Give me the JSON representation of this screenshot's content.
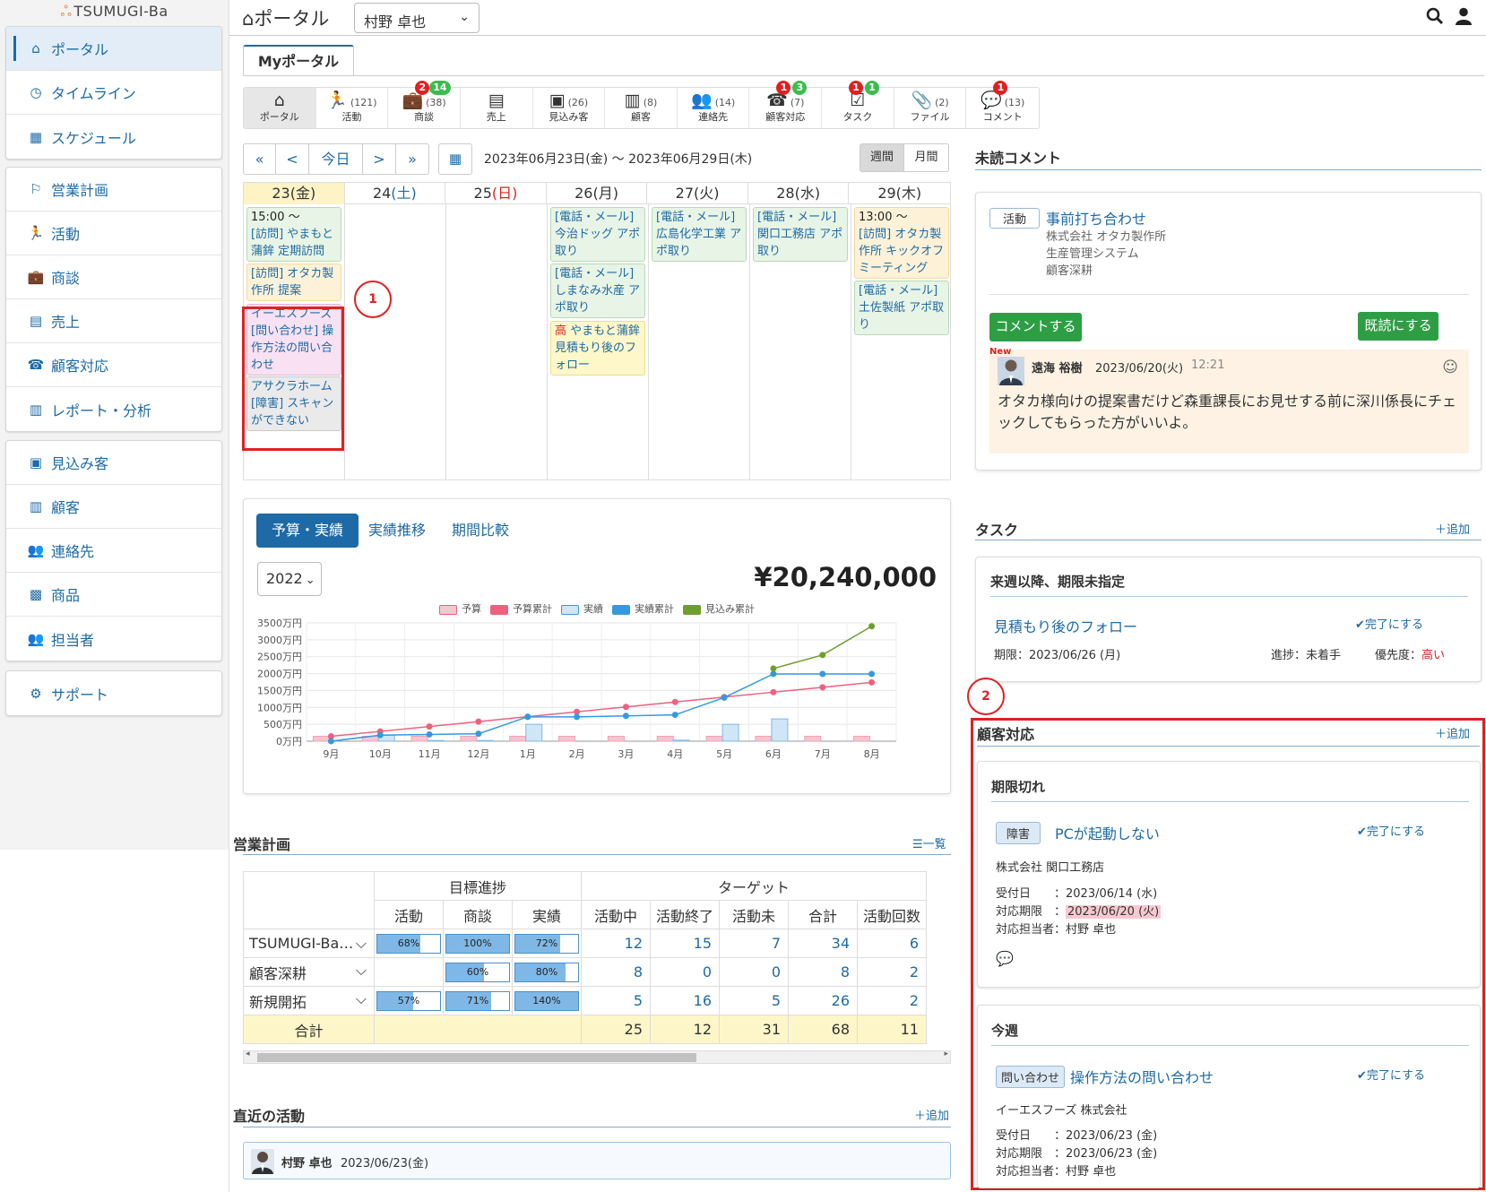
{
  "sidebar": {
    "brand": "TSUMUGI-Ba",
    "group1": [
      {
        "label": "ポータル",
        "icon": "home-icon",
        "glyph": "⌂",
        "active": true
      },
      {
        "label": "タイムライン",
        "icon": "clock-icon",
        "glyph": "◷"
      },
      {
        "label": "スケジュール",
        "icon": "calendar-icon",
        "glyph": "▦"
      }
    ],
    "group2": [
      {
        "label": "営業計画",
        "icon": "flag-icon",
        "glyph": "⚐"
      },
      {
        "label": "活動",
        "icon": "running-icon",
        "glyph": "🏃"
      },
      {
        "label": "商談",
        "icon": "briefcase-icon",
        "glyph": "💼"
      },
      {
        "label": "売上",
        "icon": "invoice-icon",
        "glyph": "▤"
      },
      {
        "label": "顧客対応",
        "icon": "phone-icon",
        "glyph": "☎"
      },
      {
        "label": "レポート・分析",
        "icon": "bar-chart-icon",
        "glyph": "▥"
      }
    ],
    "group3": [
      {
        "label": "見込み客",
        "icon": "id-card-icon",
        "glyph": "▣"
      },
      {
        "label": "顧客",
        "icon": "building-icon",
        "glyph": "▥"
      },
      {
        "label": "連絡先",
        "icon": "users-icon",
        "glyph": "👥"
      },
      {
        "label": "商品",
        "icon": "boxes-icon",
        "glyph": "▩"
      },
      {
        "label": "担当者",
        "icon": "users-icon",
        "glyph": "👥"
      }
    ],
    "group4": [
      {
        "label": "サポート",
        "icon": "user-gear-icon",
        "glyph": "⚙"
      }
    ]
  },
  "header": {
    "title": "ポータル",
    "user_select": "村野 卓也"
  },
  "tab": "Myポータル",
  "quick": [
    {
      "label": "ポータル",
      "count": "",
      "icon": "home-icon",
      "glyph": "⌂"
    },
    {
      "label": "活動",
      "count": "(121)",
      "icon": "running-icon",
      "glyph": "🏃"
    },
    {
      "label": "商談",
      "count": "(38)",
      "icon": "briefcase-icon",
      "glyph": "💼",
      "badge_red": "2",
      "badge_green": "14"
    },
    {
      "label": "売上",
      "count": "",
      "icon": "invoice-icon",
      "glyph": "▤"
    },
    {
      "label": "見込み客",
      "count": "(26)",
      "icon": "id-card-icon",
      "glyph": "▣"
    },
    {
      "label": "顧客",
      "count": "(8)",
      "icon": "building-icon",
      "glyph": "▥"
    },
    {
      "label": "連絡先",
      "count": "(14)",
      "icon": "users-icon",
      "glyph": "👥"
    },
    {
      "label": "顧客対応",
      "count": "(7)",
      "icon": "phone-icon",
      "glyph": "☎",
      "badge_red": "1",
      "badge_green": "3"
    },
    {
      "label": "タスク",
      "count": "",
      "icon": "tasks-icon",
      "glyph": "☑",
      "badge_red": "1",
      "badge_green": "1"
    },
    {
      "label": "ファイル",
      "count": "(2)",
      "icon": "paperclip-icon",
      "glyph": "📎"
    },
    {
      "label": "コメント",
      "count": "(13)",
      "icon": "comments-icon",
      "glyph": "💬",
      "badge_red": "1"
    }
  ],
  "calendar": {
    "nav": [
      "«",
      "<",
      "今日",
      ">",
      "»"
    ],
    "range": "2023年06月23日(金) ～ 2023年06月29日(木)",
    "view_week": "週間",
    "view_month": "月間",
    "days": [
      {
        "num": "23",
        "dow": "(金)",
        "kind": "today"
      },
      {
        "num": "24",
        "dow": "(土)",
        "kind": "sat"
      },
      {
        "num": "25",
        "dow": "(日)",
        "kind": "sun"
      },
      {
        "num": "26",
        "dow": "(月)",
        "kind": ""
      },
      {
        "num": "27",
        "dow": "(火)",
        "kind": ""
      },
      {
        "num": "28",
        "dow": "(水)",
        "kind": ""
      },
      {
        "num": "29",
        "dow": "(木)",
        "kind": ""
      }
    ],
    "events": {
      "e1_time": "15:00 ～",
      "e1_text": "[訪問] やまもと蒲鉾 定期訪問",
      "e2_text": "[訪問] オタカ製作所 提案",
      "e3_text": "イーエスフーズ [問い合わせ] 操作方法の問い合わせ",
      "e4_text": "アサクラホーム [障害] スキャンができない",
      "e5_text": "[電話・メール] 今治ドッグ アポ取り",
      "e6_text": "[電話・メール] しまなみ水産 アポ取り",
      "e7_pri": "高",
      "e7_text": "やまもと蒲鉾 見積もり後のフォロー",
      "e8_text": "[電話・メール] 広島化学工業 アポ取り",
      "e9_text": "[電話・メール] 関口工務店 アポ取り",
      "e10_time": "13:00 ～",
      "e10_text": "[訪問] オタカ製作所 キックオフミーティング",
      "e11_text": "[電話・メール] 土佐製紙 アポ取り"
    }
  },
  "annotations": {
    "one": "1",
    "two": "2"
  },
  "budget": {
    "tabs": [
      "予算・実績",
      "実績推移",
      "期間比較"
    ],
    "year": "2022",
    "total": "¥20,240,000"
  },
  "chart_data": {
    "type": "bar",
    "categories": [
      "9月",
      "10月",
      "11月",
      "12月",
      "1月",
      "2月",
      "3月",
      "4月",
      "5月",
      "6月",
      "7月",
      "8月"
    ],
    "y_ticks": [
      "0万円",
      "500万円",
      "1000万円",
      "1500万円",
      "2000万円",
      "2500万円",
      "3000万円",
      "3500万円"
    ],
    "ylim": [
      0,
      3500
    ],
    "unit": "万円",
    "series": [
      {
        "name": "予算",
        "kind": "bar",
        "color": "#f7c5d0",
        "values": [
          145,
          145,
          145,
          145,
          145,
          145,
          145,
          145,
          145,
          145,
          145,
          145
        ]
      },
      {
        "name": "予算累計",
        "kind": "line",
        "color": "#f0607f",
        "values": [
          145,
          290,
          435,
          580,
          725,
          870,
          1015,
          1160,
          1305,
          1450,
          1595,
          1740
        ]
      },
      {
        "name": "実績",
        "kind": "bar",
        "color": "#cfe6f7",
        "values": [
          0,
          180,
          20,
          20,
          500,
          0,
          0,
          30,
          500,
          660,
          0,
          0
        ]
      },
      {
        "name": "実績累計",
        "kind": "line",
        "color": "#3599e0",
        "values": [
          0,
          180,
          200,
          220,
          720,
          720,
          750,
          780,
          1290,
          1990,
          1990,
          1990
        ]
      },
      {
        "name": "見込み累計",
        "kind": "line",
        "color": "#6e9e2c",
        "values": [
          null,
          null,
          null,
          null,
          null,
          null,
          null,
          null,
          null,
          2150,
          2550,
          3400
        ]
      }
    ],
    "grid": true,
    "legend": "top"
  },
  "plan": {
    "title": "営業計画",
    "link": "一覧",
    "h_target_progress": "目標進捗",
    "h_target": "ターゲット",
    "cols": [
      "活動",
      "商談",
      "実績",
      "活動中",
      "活動終了",
      "活動未",
      "合計",
      "活動回数"
    ],
    "rows": [
      {
        "name": "TSUMUGI-Ba…",
        "p1": 68,
        "p1t": "68%",
        "p2": 100,
        "p2t": "100%",
        "p3": 72,
        "p3t": "72%",
        "v": [
          "12",
          "15",
          "7",
          "34",
          "6"
        ]
      },
      {
        "name": "顧客深耕",
        "p1": null,
        "p1t": "",
        "p2": 60,
        "p2t": "60%",
        "p3": 80,
        "p3t": "80%",
        "v": [
          "8",
          "0",
          "0",
          "8",
          "2"
        ]
      },
      {
        "name": "新規開拓",
        "p1": 57,
        "p1t": "57%",
        "p2": 71,
        "p2t": "71%",
        "p3": 100,
        "p3t": "140%",
        "v": [
          "5",
          "16",
          "5",
          "26",
          "2"
        ]
      }
    ],
    "sum_label": "合計",
    "sum": [
      "25",
      "12",
      "31",
      "68",
      "11"
    ]
  },
  "recent": {
    "title": "直近の活動",
    "add": "追加",
    "user": "村野 卓也",
    "date": "2023/06/23(金)"
  },
  "unread": {
    "title": "未読コメント",
    "tag": "活動",
    "subject": "事前打ち合わせ",
    "lines": [
      "株式会社 オタカ製作所",
      "生産管理システム",
      "顧客深耕"
    ],
    "btn_comment": "コメントする",
    "btn_read": "既読にする",
    "new": "New",
    "author": "遠海 裕樹",
    "date": "2023/06/20(火)",
    "time": "12:21",
    "body": "オタカ様向けの提案書だけど森重課長にお見せする前に深川係長にチェックしてもらった方がいいよ。"
  },
  "tasks": {
    "title": "タスク",
    "add": "追加",
    "section": "来週以降、期限未指定",
    "item": "見積もり後のフォロー",
    "done": "完了にする",
    "due": "期限：2023/06/26 (月)",
    "status_label": "進捗：",
    "status": "未着手",
    "prio_label": "優先度：",
    "prio": "高い"
  },
  "support": {
    "title": "顧客対応",
    "add": "追加",
    "done": "完了にする",
    "s1": "期限切れ",
    "c1_tag": "障害",
    "c1_subject": "PCが起動しない",
    "c1_company": "株式会社 関口工務店",
    "c1_recv_label": "受付日　　：",
    "c1_recv": "2023/06/14 (水)",
    "c1_due_label": "対応期限　：",
    "c1_due": "2023/06/20 (火)",
    "c1_owner_label": "対応担当者：",
    "c1_owner": "村野 卓也",
    "s2": "今週",
    "c2_tag": "問い合わせ",
    "c2_subject": "操作方法の問い合わせ",
    "c2_company": "イーエスフーズ 株式会社",
    "c2_recv_label": "受付日　　：",
    "c2_recv": "2023/06/23 (金)",
    "c2_due_label": "対応期限　：",
    "c2_due": "2023/06/23 (金)",
    "c2_owner_label": "対応担当者：",
    "c2_owner": "村野 卓也"
  }
}
